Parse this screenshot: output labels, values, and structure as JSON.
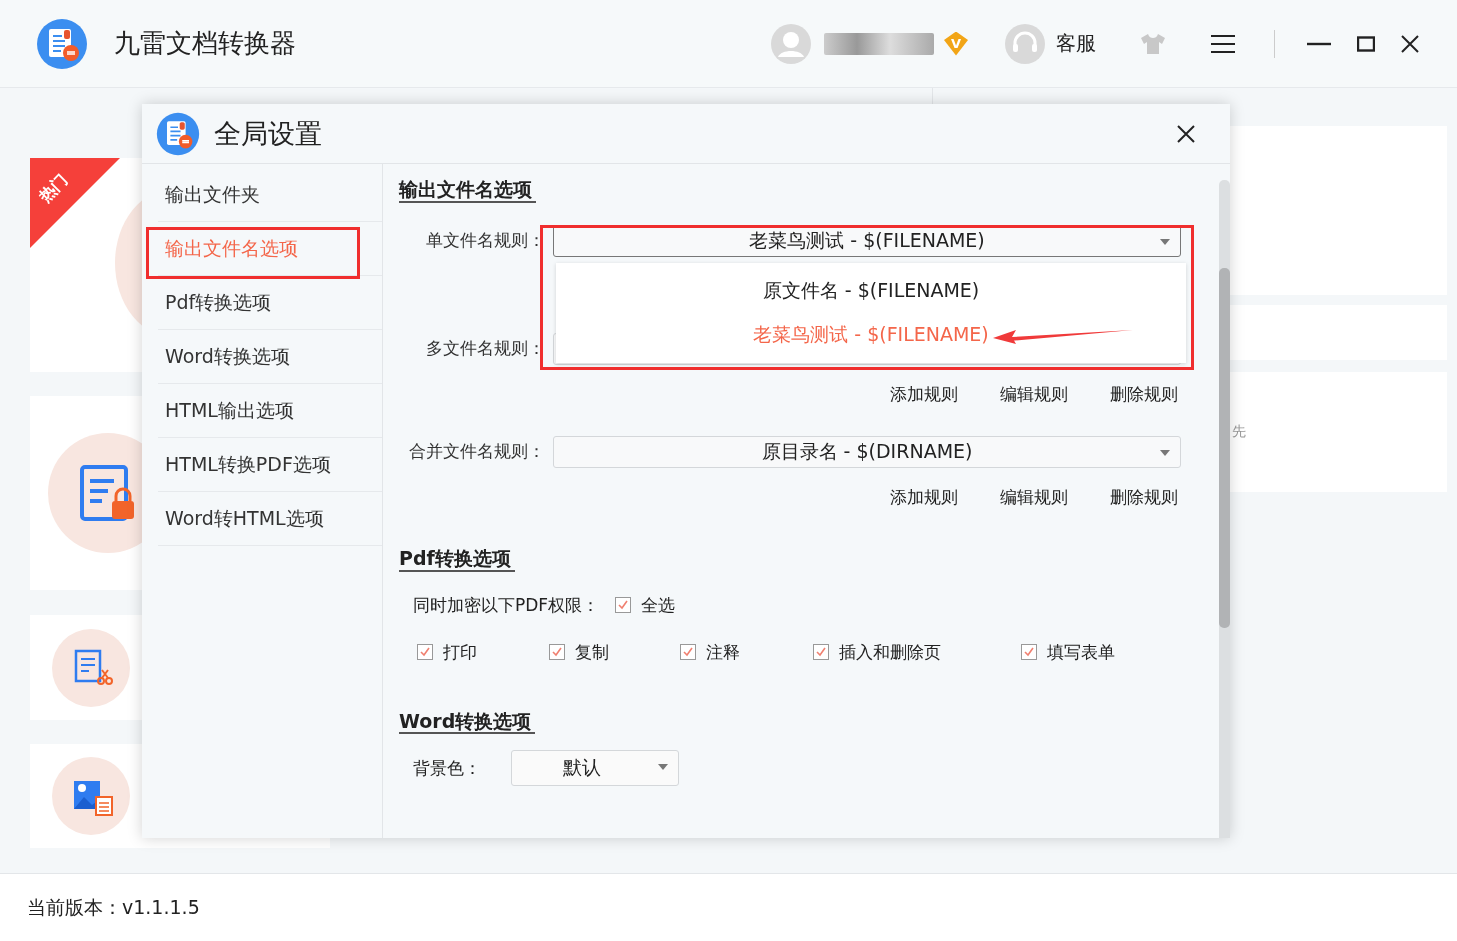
{
  "app": {
    "title": "九雷文档转换器",
    "vip_badge": "V",
    "support": "客服",
    "version": "当前版本：v1.1.1.5"
  },
  "background": {
    "hot_ribbon": "热门",
    "side_text": "先"
  },
  "dialog": {
    "title": "全局设置",
    "nav": [
      {
        "label": "输出文件夹",
        "selected": false
      },
      {
        "label": "输出文件名选项",
        "selected": true
      },
      {
        "label": "Pdf转换选项",
        "selected": false
      },
      {
        "label": "Word转换选项",
        "selected": false
      },
      {
        "label": "HTML输出选项",
        "selected": false
      },
      {
        "label": "HTML转换PDF选项",
        "selected": false
      },
      {
        "label": "Word转HTML选项",
        "selected": false
      }
    ],
    "filename_options": {
      "heading": "输出文件名选项",
      "single": {
        "label": "单文件名规则：",
        "value": "老菜鸟测试 - $(FILENAME)",
        "expanded": true,
        "options": [
          {
            "label": "原文件名 - $(FILENAME)",
            "selected": false
          },
          {
            "label": "老菜鸟测试 - $(FILENAME)",
            "selected": true
          }
        ]
      },
      "multi": {
        "label": "多文件名规则："
      },
      "rule_buttons": [
        "添加规则",
        "编辑规则",
        "删除规则"
      ],
      "merge": {
        "label": "合并文件名规则：",
        "value": "原目录名 - $(DIRNAME)"
      },
      "merge_buttons": [
        "添加规则",
        "编辑规则",
        "删除规则"
      ]
    },
    "pdf_options": {
      "heading": "Pdf转换选项",
      "encrypt_label": "同时加密以下PDF权限：",
      "select_all": {
        "label": "全选",
        "checked": true
      },
      "permissions": [
        {
          "label": "打印",
          "checked": true
        },
        {
          "label": "复制",
          "checked": true
        },
        {
          "label": "注释",
          "checked": true
        },
        {
          "label": "插入和删除页",
          "checked": true
        },
        {
          "label": "填写表单",
          "checked": true
        }
      ]
    },
    "word_options": {
      "heading": "Word转换选项",
      "bg_label": "背景色：",
      "bg_value": "默认"
    }
  }
}
